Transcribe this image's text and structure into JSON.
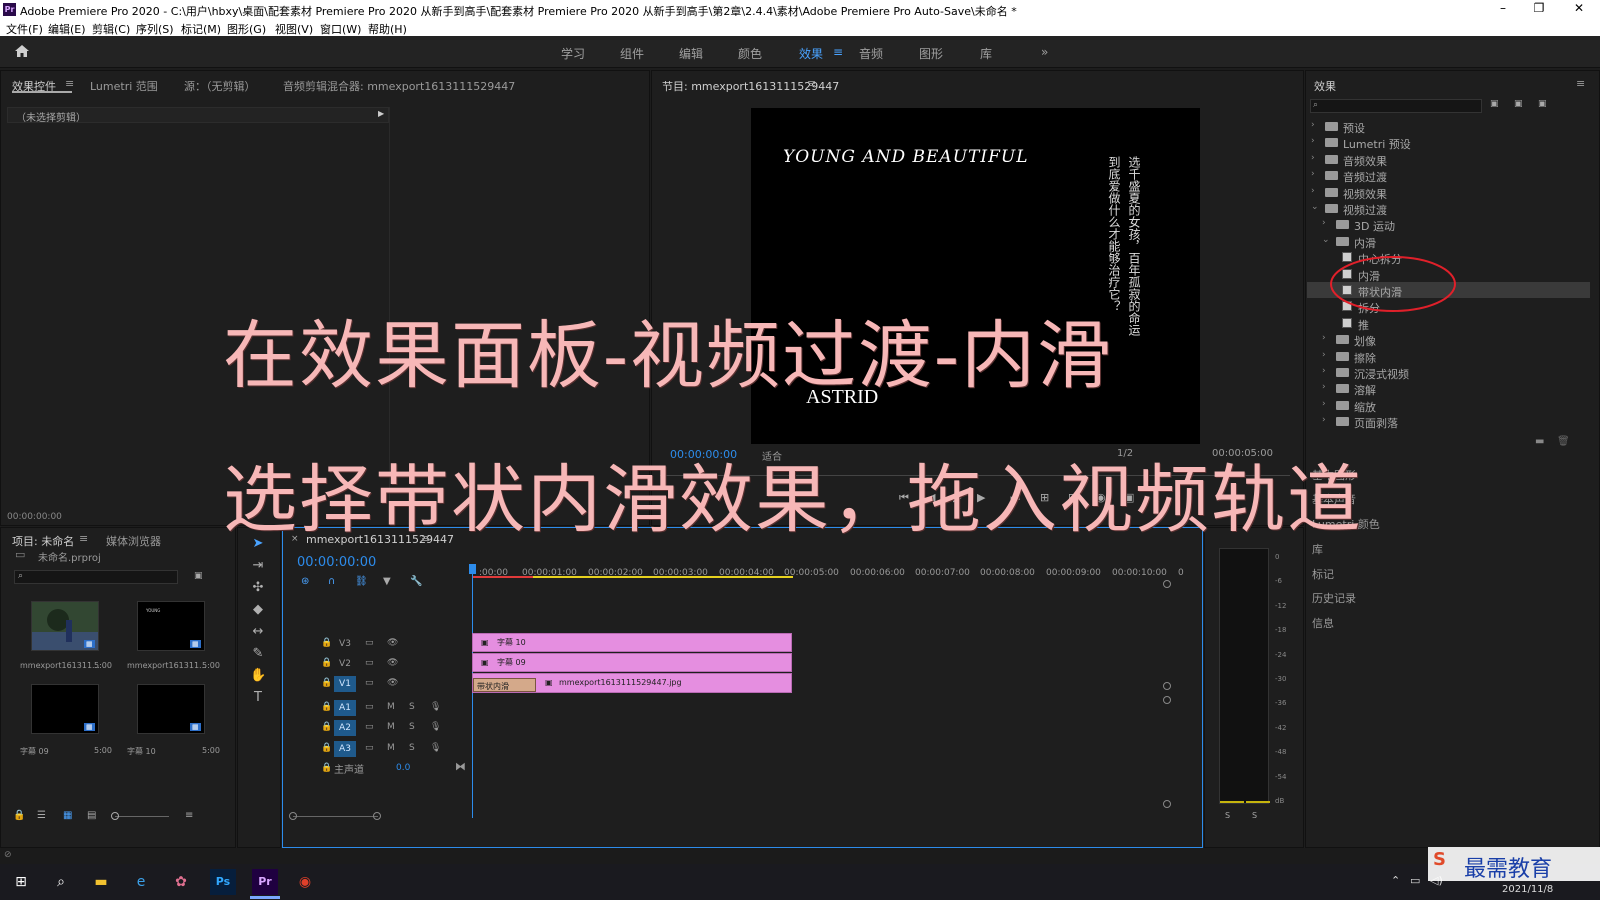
{
  "window": {
    "title": "Adobe Premiere Pro 2020 - C:\\用户\\hbxy\\桌面\\配套素材 Premiere Pro 2020 从新手到高手\\配套素材 Premiere Pro 2020 从新手到高手\\第2章\\2.4.4\\素材\\Adobe Premiere Pro Auto-Save\\未命名 *",
    "app_icon": "Pr",
    "minimize": "–",
    "restore": "❐",
    "close": "✕"
  },
  "menu": [
    "文件(F)",
    "编辑(E)",
    "剪辑(C)",
    "序列(S)",
    "标记(M)",
    "图形(G)",
    "视图(V)",
    "窗口(W)",
    "帮助(H)"
  ],
  "workspaces": [
    "学习",
    "组件",
    "编辑",
    "颜色",
    "效果",
    "音频",
    "图形",
    "库"
  ],
  "workspace_active": "效果",
  "workspace_more": "»",
  "source_panel": {
    "tabs": [
      "效果控件",
      "Lumetri 范围",
      "源：（无剪辑）",
      "音频剪辑混合器: mmexport1613111529447"
    ],
    "no_clip": "（未选择剪辑）",
    "timecode": "00:00:00:00"
  },
  "program_panel": {
    "tab": "节目: mmexport1613111529447",
    "video_title": "YOUNG AND BEAUTIFUL",
    "video_name": "ASTRID",
    "vertical_text_1": "选千盛夏的女孩，百年孤寂的命运",
    "vertical_text_2": "到底爱做什么才能够治疗它？",
    "timecode": "00:00:00:00",
    "fit": "适合",
    "resolution": "1/2",
    "duration": "00:00:05:00"
  },
  "overlay": {
    "line1": "在效果面板-视频过渡-内滑",
    "line2": "选择带状内滑效果，拖入视频轨道"
  },
  "effects_panel": {
    "title": "效果",
    "items": [
      {
        "label": "预设",
        "level": 0,
        "open": false
      },
      {
        "label": "Lumetri 预设",
        "level": 0,
        "open": false
      },
      {
        "label": "音频效果",
        "level": 0,
        "open": false
      },
      {
        "label": "音频过渡",
        "level": 0,
        "open": false
      },
      {
        "label": "视频效果",
        "level": 0,
        "open": false
      },
      {
        "label": "视频过渡",
        "level": 0,
        "open": true
      },
      {
        "label": "3D 运动",
        "level": 1,
        "open": false
      },
      {
        "label": "内滑",
        "level": 1,
        "open": true
      },
      {
        "label": "中心拆分",
        "level": 2,
        "fx": true
      },
      {
        "label": "内滑",
        "level": 2,
        "fx": true
      },
      {
        "label": "带状内滑",
        "level": 2,
        "fx": true,
        "selected": true
      },
      {
        "label": "拆分",
        "level": 2,
        "fx": true
      },
      {
        "label": "推",
        "level": 2,
        "fx": true
      },
      {
        "label": "划像",
        "level": 1,
        "open": false
      },
      {
        "label": "擦除",
        "level": 1,
        "open": false
      },
      {
        "label": "沉浸式视频",
        "level": 1,
        "open": false
      },
      {
        "label": "溶解",
        "level": 1,
        "open": false
      },
      {
        "label": "缩放",
        "level": 1,
        "open": false
      },
      {
        "label": "页面剥落",
        "level": 1,
        "open": false
      }
    ],
    "lower_tabs": [
      "基本图形",
      "基本声音",
      "Lumetri 颜色",
      "库",
      "标记",
      "历史记录",
      "信息"
    ]
  },
  "project_panel": {
    "tabs": [
      "项目: 未命名",
      "媒体浏览器"
    ],
    "file": "未命名.prproj",
    "items": [
      {
        "name": "mmexport161311...",
        "dur": "5:00"
      },
      {
        "name": "mmexport161311...",
        "dur": "5:00"
      },
      {
        "name": "字幕 09",
        "dur": "5:00"
      },
      {
        "name": "字幕 10",
        "dur": "5:00"
      }
    ]
  },
  "timeline": {
    "tab": "mmexport1613111529447",
    "timecode": "00:00:00:00",
    "ruler": [
      ":00:00",
      "00:00:01:00",
      "00:00:02:00",
      "00:00:03:00",
      "00:00:04:00",
      "00:00:05:00",
      "00:00:06:00",
      "00:00:07:00",
      "00:00:08:00",
      "00:00:09:00",
      "00:00:10:00",
      "0"
    ],
    "video_tracks": [
      "V3",
      "V2",
      "V1"
    ],
    "audio_tracks": [
      "A1",
      "A2",
      "A3"
    ],
    "master": "主声道",
    "master_val": "0.0",
    "clips": {
      "v3": "字幕 10",
      "v2": "字幕 09",
      "v1": "mmexport1613111529447.jpg",
      "transition": "带状内滑"
    },
    "m_label": "M",
    "s_label": "S"
  },
  "meter": {
    "scale": [
      "0",
      "-6",
      "-12",
      "-18",
      "-24",
      "-30",
      "-36",
      "-42",
      "-48",
      "-54",
      "dB"
    ],
    "solo": [
      "S",
      "S"
    ]
  },
  "taskbar": {
    "date": "2021/11/8",
    "watermark": "最需教育"
  },
  "colors": {
    "accent_blue": "#2d8ceb",
    "clip_pink": "#e58ee0",
    "overlay_pink": "#f7b7b7",
    "highlight_red": "#e0202a"
  }
}
